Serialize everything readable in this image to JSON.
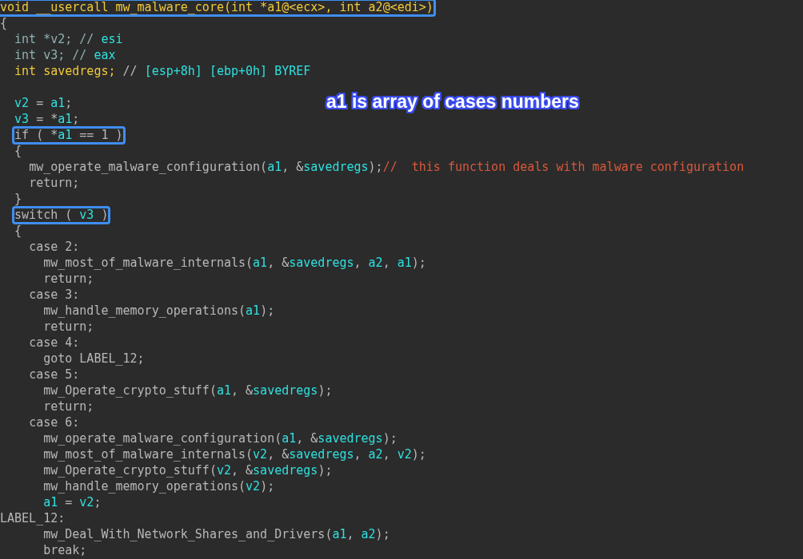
{
  "annotation": "a1 is array of cases numbers",
  "lines": [
    {
      "boxed": true,
      "tokens": [
        {
          "kind": "function",
          "text": "void __usercall mw_malware_core(int *a1@<ecx>, int a2@<edi>)"
        }
      ]
    },
    {
      "boxed": false,
      "tokens": [
        {
          "kind": "plain",
          "text": "{"
        }
      ]
    },
    {
      "boxed": false,
      "tokens": [
        {
          "kind": "type",
          "text": "  int *v2; // "
        },
        {
          "kind": "variable",
          "text": "esi"
        }
      ]
    },
    {
      "boxed": false,
      "tokens": [
        {
          "kind": "type",
          "text": "  int v3; // "
        },
        {
          "kind": "variable",
          "text": "eax"
        }
      ]
    },
    {
      "boxed": false,
      "tokens": [
        {
          "kind": "function",
          "text": "  int savedregs;"
        },
        {
          "kind": "plain",
          "text": " // "
        },
        {
          "kind": "variable",
          "text": "[esp+8h] [ebp+0h] BYREF"
        }
      ]
    },
    {
      "boxed": false
    },
    {
      "boxed": false,
      "tokens": [
        {
          "kind": "variable",
          "text": "  v2"
        },
        {
          "kind": "plain",
          "text": " = "
        },
        {
          "kind": "variable",
          "text": "a1"
        },
        {
          "kind": "plain",
          "text": ";"
        }
      ]
    },
    {
      "boxed": false,
      "tokens": [
        {
          "kind": "variable",
          "text": "  v3"
        },
        {
          "kind": "plain",
          "text": " = *"
        },
        {
          "kind": "variable",
          "text": "a1"
        },
        {
          "kind": "plain",
          "text": ";"
        }
      ]
    },
    {
      "boxed": true,
      "tokens": [
        {
          "kind": "plain",
          "text": "  if ( *"
        },
        {
          "kind": "variable",
          "text": "a1"
        },
        {
          "kind": "plain",
          "text": " == 1 )"
        }
      ]
    },
    {
      "boxed": false,
      "tokens": [
        {
          "kind": "plain",
          "text": "  {"
        }
      ]
    },
    {
      "boxed": false,
      "tokens": [
        {
          "kind": "plain",
          "text": "    mw_operate_malware_configuration("
        },
        {
          "kind": "variable",
          "text": "a1"
        },
        {
          "kind": "plain",
          "text": ", &"
        },
        {
          "kind": "variable",
          "text": "savedregs"
        },
        {
          "kind": "plain",
          "text": ");"
        },
        {
          "kind": "comment",
          "text": "//  this function deals with malware configuration"
        }
      ]
    },
    {
      "boxed": false,
      "tokens": [
        {
          "kind": "plain",
          "text": "    return;"
        }
      ]
    },
    {
      "boxed": false,
      "tokens": [
        {
          "kind": "plain",
          "text": "  }"
        }
      ]
    },
    {
      "boxed": true,
      "tokens": [
        {
          "kind": "plain",
          "text": "  switch ( "
        },
        {
          "kind": "variable",
          "text": "v3"
        },
        {
          "kind": "plain",
          "text": " )"
        }
      ]
    },
    {
      "boxed": false,
      "tokens": [
        {
          "kind": "plain",
          "text": "  {"
        }
      ]
    },
    {
      "boxed": false,
      "tokens": [
        {
          "kind": "plain",
          "text": "    case 2:"
        }
      ]
    },
    {
      "boxed": false,
      "tokens": [
        {
          "kind": "plain",
          "text": "      mw_most_of_malware_internals("
        },
        {
          "kind": "variable",
          "text": "a1"
        },
        {
          "kind": "plain",
          "text": ", &"
        },
        {
          "kind": "variable",
          "text": "savedregs"
        },
        {
          "kind": "plain",
          "text": ", "
        },
        {
          "kind": "variable",
          "text": "a2"
        },
        {
          "kind": "plain",
          "text": ", "
        },
        {
          "kind": "variable",
          "text": "a1"
        },
        {
          "kind": "plain",
          "text": ");"
        }
      ]
    },
    {
      "boxed": false,
      "tokens": [
        {
          "kind": "plain",
          "text": "      return;"
        }
      ]
    },
    {
      "boxed": false,
      "tokens": [
        {
          "kind": "plain",
          "text": "    case 3:"
        }
      ]
    },
    {
      "boxed": false,
      "tokens": [
        {
          "kind": "plain",
          "text": "      mw_handle_memory_operations("
        },
        {
          "kind": "variable",
          "text": "a1"
        },
        {
          "kind": "plain",
          "text": ");"
        }
      ]
    },
    {
      "boxed": false,
      "tokens": [
        {
          "kind": "plain",
          "text": "      return;"
        }
      ]
    },
    {
      "boxed": false,
      "tokens": [
        {
          "kind": "plain",
          "text": "    case 4:"
        }
      ]
    },
    {
      "boxed": false,
      "tokens": [
        {
          "kind": "plain",
          "text": "      goto LABEL_12;"
        }
      ]
    },
    {
      "boxed": false,
      "tokens": [
        {
          "kind": "plain",
          "text": "    case 5:"
        }
      ]
    },
    {
      "boxed": false,
      "tokens": [
        {
          "kind": "plain",
          "text": "      mw_Operate_crypto_stuff("
        },
        {
          "kind": "variable",
          "text": "a1"
        },
        {
          "kind": "plain",
          "text": ", &"
        },
        {
          "kind": "variable",
          "text": "savedregs"
        },
        {
          "kind": "plain",
          "text": ");"
        }
      ]
    },
    {
      "boxed": false,
      "tokens": [
        {
          "kind": "plain",
          "text": "      return;"
        }
      ]
    },
    {
      "boxed": false,
      "tokens": [
        {
          "kind": "plain",
          "text": "    case 6:"
        }
      ]
    },
    {
      "boxed": false,
      "tokens": [
        {
          "kind": "plain",
          "text": "      mw_operate_malware_configuration("
        },
        {
          "kind": "variable",
          "text": "a1"
        },
        {
          "kind": "plain",
          "text": ", &"
        },
        {
          "kind": "variable",
          "text": "savedregs"
        },
        {
          "kind": "plain",
          "text": ");"
        }
      ]
    },
    {
      "boxed": false,
      "tokens": [
        {
          "kind": "plain",
          "text": "      mw_most_of_malware_internals("
        },
        {
          "kind": "variable",
          "text": "v2"
        },
        {
          "kind": "plain",
          "text": ", &"
        },
        {
          "kind": "variable",
          "text": "savedregs"
        },
        {
          "kind": "plain",
          "text": ", "
        },
        {
          "kind": "variable",
          "text": "a2"
        },
        {
          "kind": "plain",
          "text": ", "
        },
        {
          "kind": "variable",
          "text": "v2"
        },
        {
          "kind": "plain",
          "text": ");"
        }
      ]
    },
    {
      "boxed": false,
      "tokens": [
        {
          "kind": "plain",
          "text": "      mw_Operate_crypto_stuff("
        },
        {
          "kind": "variable",
          "text": "v2"
        },
        {
          "kind": "plain",
          "text": ", &"
        },
        {
          "kind": "variable",
          "text": "savedregs"
        },
        {
          "kind": "plain",
          "text": ");"
        }
      ]
    },
    {
      "boxed": false,
      "tokens": [
        {
          "kind": "plain",
          "text": "      mw_handle_memory_operations("
        },
        {
          "kind": "variable",
          "text": "v2"
        },
        {
          "kind": "plain",
          "text": ");"
        }
      ]
    },
    {
      "boxed": false,
      "tokens": [
        {
          "kind": "variable",
          "text": "      a1"
        },
        {
          "kind": "plain",
          "text": " = "
        },
        {
          "kind": "variable",
          "text": "v2"
        },
        {
          "kind": "plain",
          "text": ";"
        }
      ]
    },
    {
      "boxed": false,
      "tokens": [
        {
          "kind": "plain",
          "text": "LABEL_12:"
        }
      ]
    },
    {
      "boxed": false,
      "tokens": [
        {
          "kind": "plain",
          "text": "      mw_Deal_With_Network_Shares_and_Drivers("
        },
        {
          "kind": "variable",
          "text": "a1"
        },
        {
          "kind": "plain",
          "text": ", "
        },
        {
          "kind": "variable",
          "text": "a2"
        },
        {
          "kind": "plain",
          "text": ");"
        }
      ]
    },
    {
      "boxed": false,
      "tokens": [
        {
          "kind": "plain",
          "text": "      break;"
        }
      ]
    }
  ]
}
